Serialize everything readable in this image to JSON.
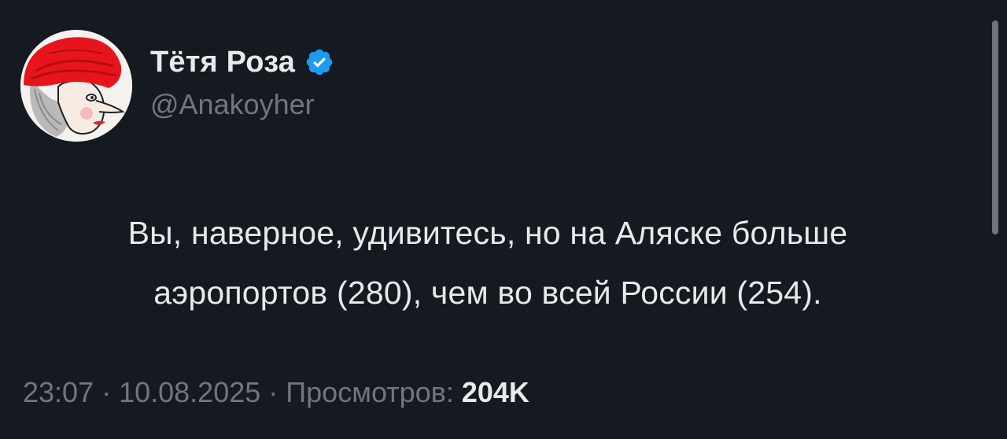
{
  "author": {
    "display_name": "Тётя Роза",
    "handle": "@Anakoyher",
    "verified": true,
    "verified_color": "#1d9bf0",
    "avatar": "avatar-icon"
  },
  "tweet": {
    "lines": [
      "Вы, наверное, удивитесь, но на Аляске больше",
      "аэропортов (280), чем во всей России (254)."
    ]
  },
  "meta": {
    "time": "23:07",
    "date": "10.08.2025",
    "views_label": "Просмотров:",
    "views_count": "204K",
    "separator": "·"
  },
  "colors": {
    "background": "#151a21",
    "text_primary": "#e7e9ea",
    "text_secondary": "#71767b"
  }
}
